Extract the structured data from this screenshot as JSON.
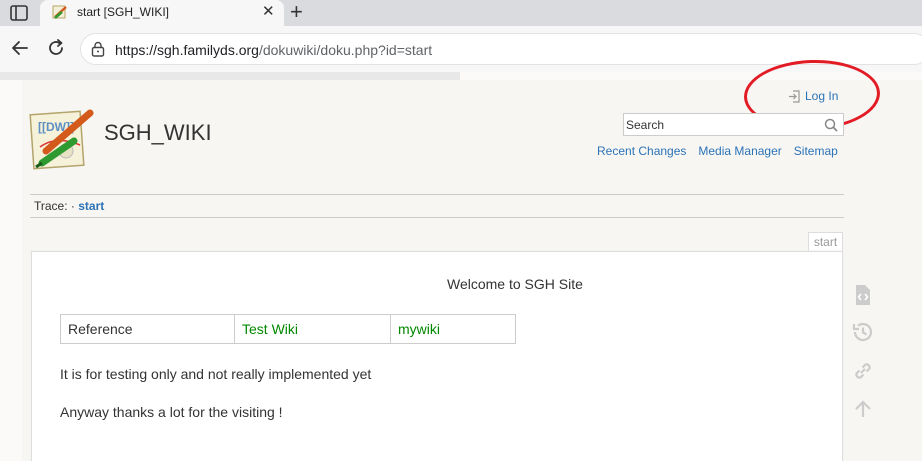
{
  "browser": {
    "tab_title": "start [SGH_WIKI]",
    "url_host": "https://sgh.familyds.org",
    "url_path": "/dokuwiki/doku.php?id=start"
  },
  "header": {
    "login_label": "Log In",
    "site_title": "SGH_WIKI",
    "search_placeholder": "Search",
    "links": [
      "Recent Changes",
      "Media Manager",
      "Sitemap"
    ]
  },
  "breadcrumb": {
    "label": "Trace:",
    "separator": "·",
    "current": "start"
  },
  "page_id": "start",
  "content": {
    "welcome": "Welcome to SGH Site",
    "table": {
      "cells": [
        "Reference",
        "Test Wiki",
        "mywiki"
      ]
    },
    "paragraph1": "It is for testing only and not really implemented yet",
    "paragraph2": "Anyway thanks a lot for the visiting !"
  },
  "annotation_color": "#e21b24",
  "link_color": "#2b73b7",
  "icons": {
    "page_tools": [
      "show-source-icon",
      "old-revisions-icon",
      "backlinks-icon",
      "back-to-top-icon"
    ]
  }
}
